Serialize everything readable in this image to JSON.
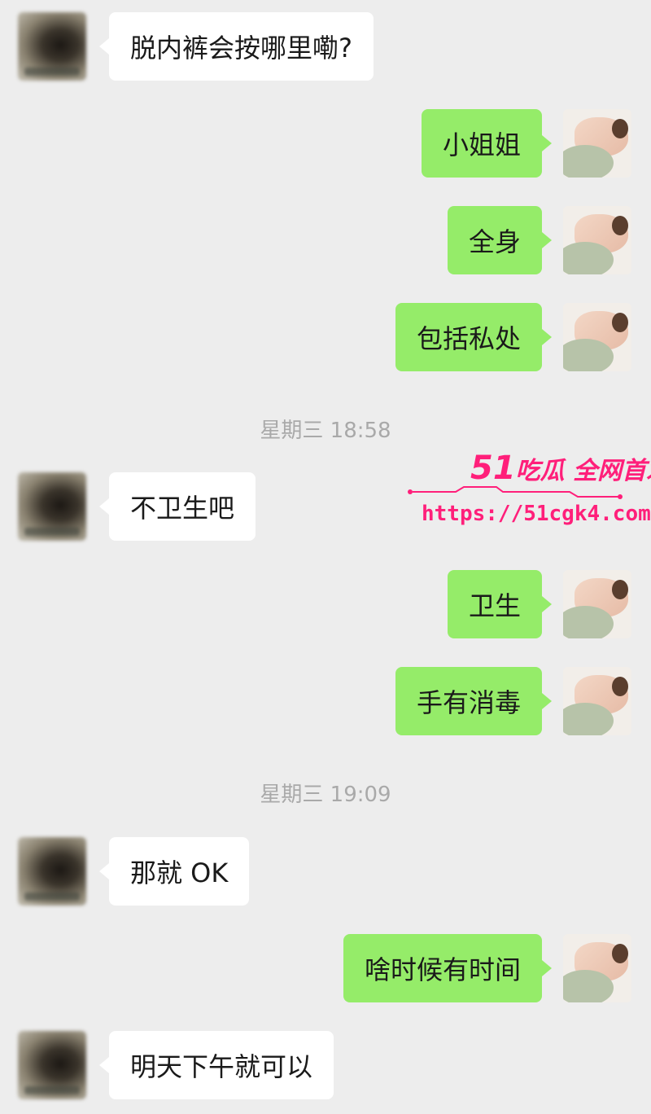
{
  "messages": [
    {
      "side": "left",
      "text": "脱内裤会按哪里嘞?"
    },
    {
      "side": "right",
      "text": "小姐姐"
    },
    {
      "side": "right",
      "text": "全身"
    },
    {
      "side": "right",
      "text": "包括私处"
    },
    {
      "side": "left",
      "text": "不卫生吧"
    },
    {
      "side": "right",
      "text": "卫生"
    },
    {
      "side": "right",
      "text": "手有消毒"
    },
    {
      "side": "left",
      "text": "那就 OK"
    },
    {
      "side": "right",
      "text": "啥时候有时间"
    },
    {
      "side": "left",
      "text": "明天下午就可以"
    }
  ],
  "timestamps": [
    "星期三 18:58",
    "星期三 19:09"
  ],
  "watermark": {
    "brand_number": "51",
    "brand_text": "吃瓜 全网首发",
    "url": "https://51cgk4.com",
    "color": "#ff1f7a"
  },
  "colors": {
    "sent_bubble": "#95ec69",
    "received_bubble": "#ffffff",
    "background": "#ededed",
    "timestamp": "#a9a9a9"
  }
}
